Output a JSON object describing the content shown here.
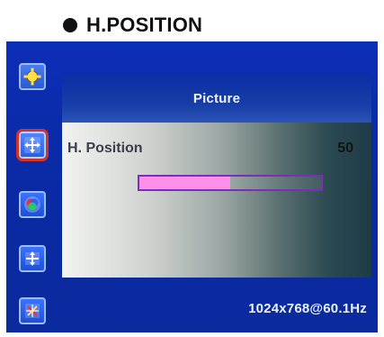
{
  "page": {
    "heading": "H.POSITION"
  },
  "osd": {
    "panel_title": "Picture",
    "setting": {
      "label": "H. Position",
      "value": "50",
      "fill_fraction": 0.5
    },
    "resolution": "1024x768@60.1Hz",
    "sidebar": [
      {
        "name": "brightness",
        "icon": "brightness-icon"
      },
      {
        "name": "h-position",
        "icon": "h-position-icon",
        "active": true
      },
      {
        "name": "color",
        "icon": "color-icon"
      },
      {
        "name": "v-position",
        "icon": "v-position-icon"
      },
      {
        "name": "advanced",
        "icon": "advanced-icon"
      }
    ]
  },
  "colors": {
    "active_outline": "#d3322a",
    "slider_fill": "#ff8fe8",
    "slider_border": "#7a2fb7"
  }
}
